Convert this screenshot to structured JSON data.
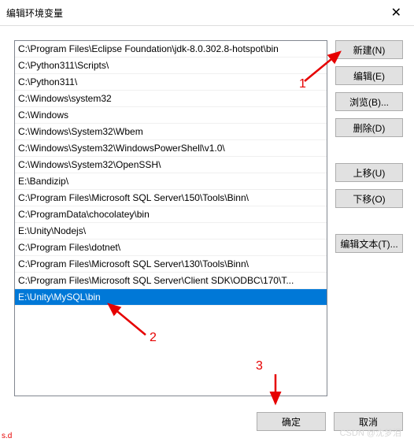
{
  "window": {
    "title": "编辑环境变量"
  },
  "paths": [
    "C:\\Program Files\\Eclipse Foundation\\jdk-8.0.302.8-hotspot\\bin",
    "C:\\Python311\\Scripts\\",
    "C:\\Python311\\",
    "C:\\Windows\\system32",
    "C:\\Windows",
    "C:\\Windows\\System32\\Wbem",
    "C:\\Windows\\System32\\WindowsPowerShell\\v1.0\\",
    "C:\\Windows\\System32\\OpenSSH\\",
    "E:\\Bandizip\\",
    "C:\\Program Files\\Microsoft SQL Server\\150\\Tools\\Binn\\",
    "C:\\ProgramData\\chocolatey\\bin",
    "E:\\Unity\\Nodejs\\",
    "C:\\Program Files\\dotnet\\",
    "C:\\Program Files\\Microsoft SQL Server\\130\\Tools\\Binn\\",
    "C:\\Program Files\\Microsoft SQL Server\\Client SDK\\ODBC\\170\\T...",
    "E:\\Unity\\MySQL\\bin"
  ],
  "selected_index": 15,
  "buttons": {
    "new": "新建(N)",
    "edit": "编辑(E)",
    "browse": "浏览(B)...",
    "delete": "删除(D)",
    "moveup": "上移(U)",
    "movedown": "下移(O)",
    "edittext": "编辑文本(T)...",
    "ok": "确定",
    "cancel": "取消"
  },
  "annotations": {
    "a1": "1",
    "a2": "2",
    "a3": "3"
  },
  "watermark": {
    "csdn": "CSDN @沈梦泪",
    "sd": "s.d"
  }
}
